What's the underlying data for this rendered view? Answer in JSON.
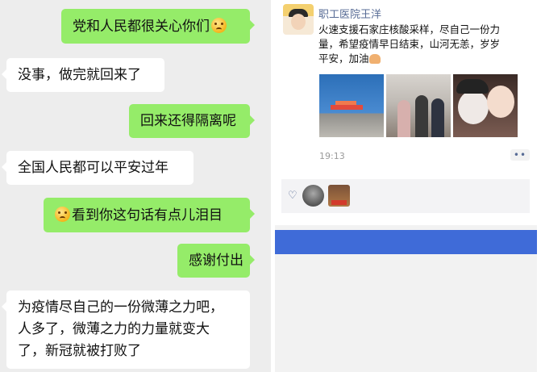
{
  "chat": {
    "messages": [
      {
        "side": "right",
        "text": "党和人民都很关心你们",
        "emoji_after": "crying-face"
      },
      {
        "side": "left",
        "text": "没事，做完就回来了"
      },
      {
        "side": "right",
        "text": "回来还得隔离呢"
      },
      {
        "side": "left",
        "text": "全国人民都可以平安过年"
      },
      {
        "side": "right",
        "text": "看到你这句话有点儿泪目",
        "emoji_before": "crying-face"
      },
      {
        "side": "right",
        "text": "感谢付出"
      },
      {
        "side": "left",
        "lines": [
          "为疫情尽自己的一份微薄之力吧，",
          "人多了，微薄之力的力量就变大",
          "了，新冠就被打败了"
        ]
      }
    ],
    "colors": {
      "background": "#ededed",
      "self_bubble": "#95ec69",
      "other_bubble": "#ffffff"
    }
  },
  "moments": {
    "author": "职工医院王洋",
    "text_lines": [
      "火速支援石家庄核酸采样，尽自己一份力",
      "量，希望疫情早日结束，山河无恙，岁岁",
      "平安，加油"
    ],
    "text_emoji": "flexed-biceps",
    "photos": [
      {
        "icon": "photo-building-sign"
      },
      {
        "icon": "photo-group-people"
      },
      {
        "icon": "photo-masked-selfie"
      }
    ],
    "time": "19:13",
    "more_icon": "more-dots",
    "likes_icon": "heart-icon",
    "liker_count": 2,
    "colors": {
      "name": "#576b95",
      "bottom_bar": "#3f6bd8"
    }
  }
}
